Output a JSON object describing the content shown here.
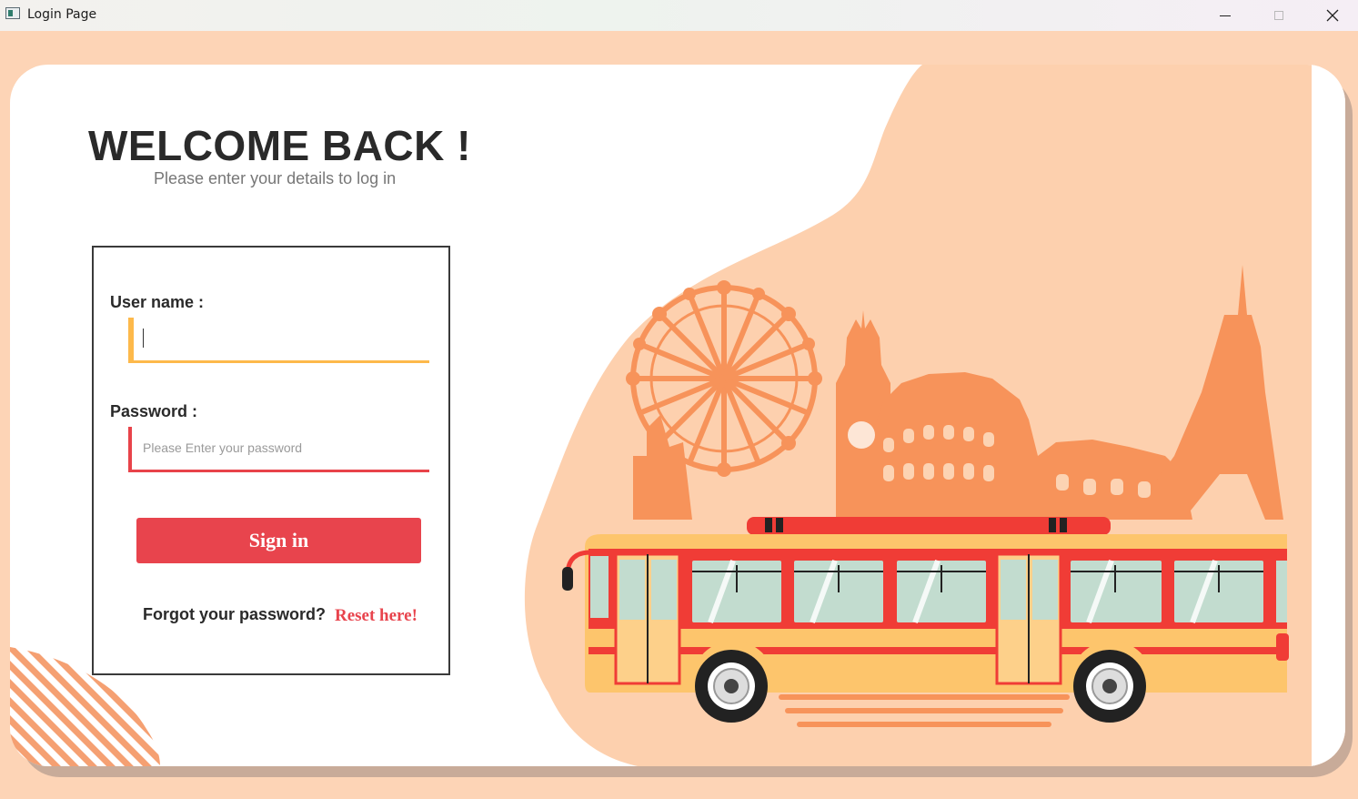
{
  "window": {
    "title": "Login Page",
    "buttons": [
      "minimize",
      "maximize",
      "close"
    ]
  },
  "login": {
    "heading": "WELCOME BACK !",
    "subtitle": "Please enter your details to log in",
    "username_label": "User name :",
    "username_value": "",
    "password_label": "Password :",
    "password_placeholder": "Please Enter your password",
    "signin_label": "Sign in",
    "forgot_text": "Forgot your password?",
    "reset_link": "Reset here!"
  },
  "colors": {
    "background": "#fdd4b6",
    "accent_red": "#e8444d",
    "accent_yellow": "#fdb94b",
    "illustration_orange": "#f7935a"
  },
  "icons": {
    "app": "app-window-icon",
    "minimize": "minimize-icon",
    "maximize": "maximize-icon",
    "close": "close-icon"
  }
}
